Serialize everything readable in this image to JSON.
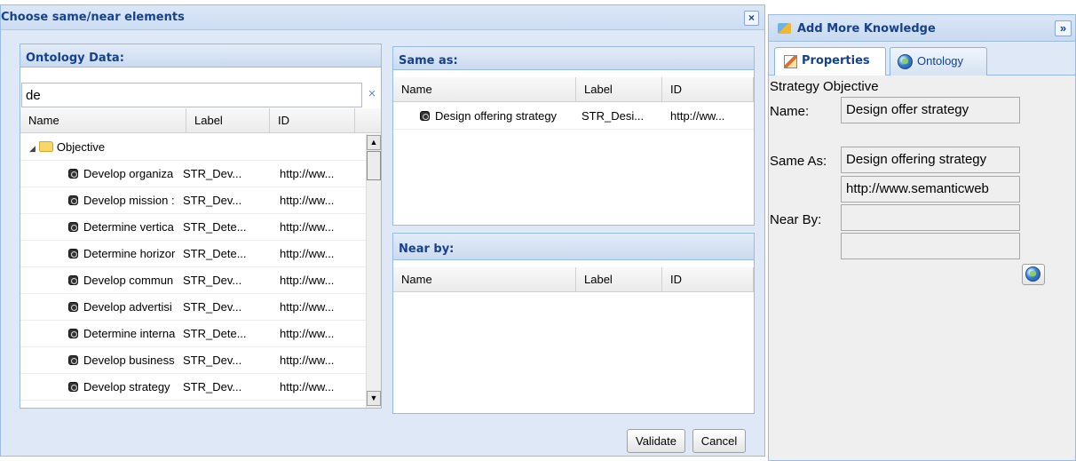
{
  "dialog": {
    "title": "Choose same/near elements",
    "close_label": "×",
    "ontology_panel": {
      "title": "Ontology Data:",
      "search_value": "de",
      "clear_label": "×",
      "columns": [
        "Name",
        "Label",
        "ID"
      ],
      "group_label": "Objective",
      "rows": [
        {
          "name": "Develop organiza",
          "label": "STR_Dev...",
          "id": "http://ww..."
        },
        {
          "name": "Develop mission :",
          "label": "STR_Dev...",
          "id": "http://ww..."
        },
        {
          "name": "Determine vertica",
          "label": "STR_Dete...",
          "id": "http://ww..."
        },
        {
          "name": "Determine horizor",
          "label": "STR_Dete...",
          "id": "http://ww..."
        },
        {
          "name": "Develop commun",
          "label": "STR_Dev...",
          "id": "http://ww..."
        },
        {
          "name": "Develop advertisi",
          "label": "STR_Dev...",
          "id": "http://ww..."
        },
        {
          "name": "Determine interna",
          "label": "STR_Dete...",
          "id": "http://ww..."
        },
        {
          "name": "Develop business",
          "label": "STR_Dev...",
          "id": "http://ww..."
        },
        {
          "name": "Develop strategy",
          "label": "STR_Dev...",
          "id": "http://ww..."
        }
      ]
    },
    "same_as_panel": {
      "title": "Same as:",
      "columns": [
        "Name",
        "Label",
        "ID"
      ],
      "rows": [
        {
          "name": "Design offering strategy",
          "label": "STR_Desi...",
          "id": "http://ww..."
        }
      ]
    },
    "near_by_panel": {
      "title": "Near by:",
      "columns": [
        "Name",
        "Label",
        "ID"
      ]
    },
    "validate_label": "Validate",
    "cancel_label": "Cancel"
  },
  "right_panel": {
    "title": "Add More Knowledge",
    "collapse_label": "»",
    "tabs": {
      "properties": "Properties",
      "ontology": "Ontology"
    },
    "properties": {
      "type_label": "Strategy Objective",
      "name_label": "Name:",
      "name_value": "Design offer strategy",
      "same_as_label": "Same As:",
      "same_as_value": "Design offering strategy",
      "same_as_uri": "http://www.semanticweb",
      "near_by_label": "Near By:",
      "near_by_value_1": "",
      "near_by_value_2": ""
    }
  },
  "icons": {
    "node": "ontology-node-icon",
    "folder": "folder-icon",
    "globe": "globe-icon",
    "pencil": "properties-pencil-icon"
  }
}
